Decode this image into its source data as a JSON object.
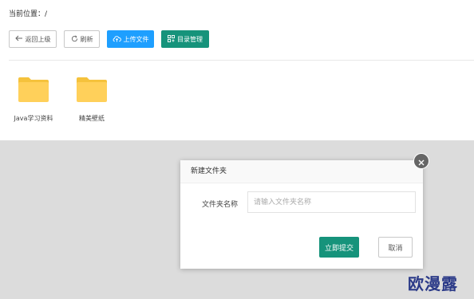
{
  "breadcrumb": {
    "label": "当前位置：/"
  },
  "toolbar": {
    "back_label": "返回上级",
    "refresh_label": "刷新",
    "upload_label": "上传文件",
    "manage_label": "目录管理"
  },
  "files": [
    {
      "name": "Java学习资料",
      "icon": "folder-icon"
    },
    {
      "name": "精美壁纸",
      "icon": "folder-icon"
    }
  ],
  "modal": {
    "title": "新建文件夹",
    "field_label": "文件夹名称",
    "field_placeholder": "请输入文件夹名称",
    "field_value": "",
    "submit_label": "立即提交",
    "cancel_label": "取消"
  },
  "watermark": "欧漫露",
  "colors": {
    "primary_blue": "#1e9fff",
    "primary_teal": "#16937b",
    "folder_yellow": "#ffd05a",
    "overlay": "#dcdcdc"
  }
}
